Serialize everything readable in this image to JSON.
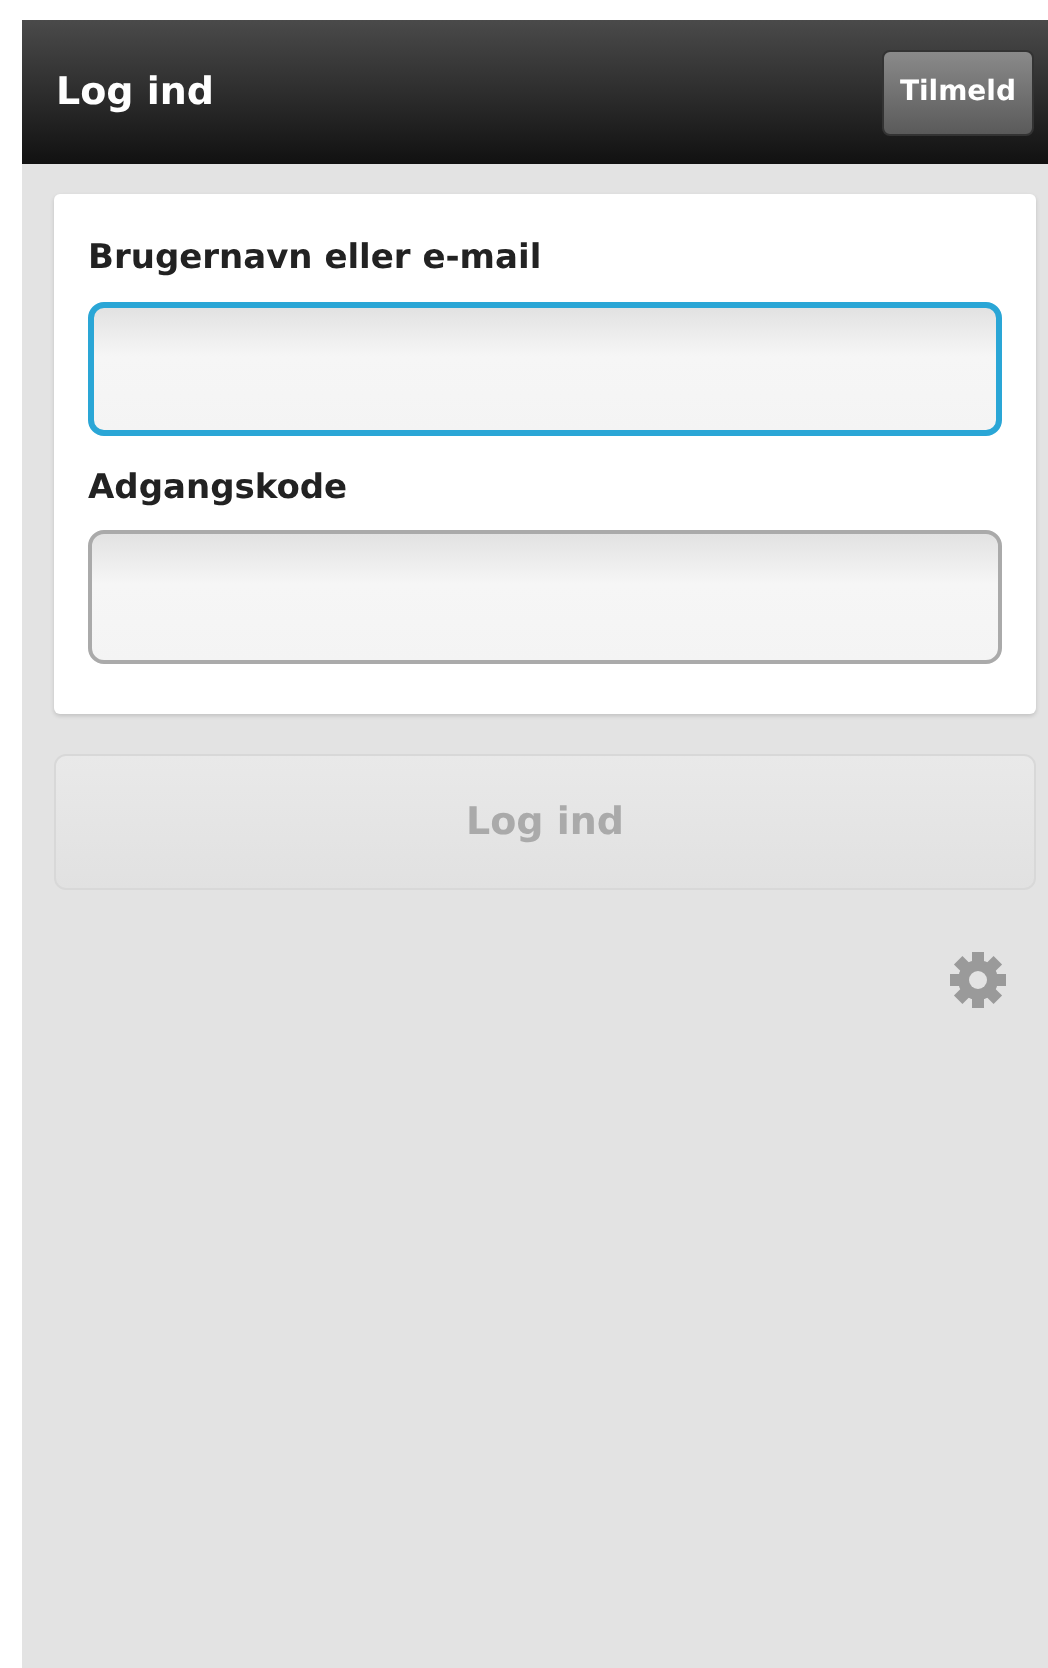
{
  "header": {
    "title": "Log ind",
    "signup_button": "Tilmeld"
  },
  "fields": [
    {
      "label": "Brugernavn eller e-mail",
      "focused": true
    },
    {
      "label": "Adgangskode",
      "focused": false
    }
  ],
  "login_button": {
    "label": "Log ind",
    "disabled": true
  }
}
